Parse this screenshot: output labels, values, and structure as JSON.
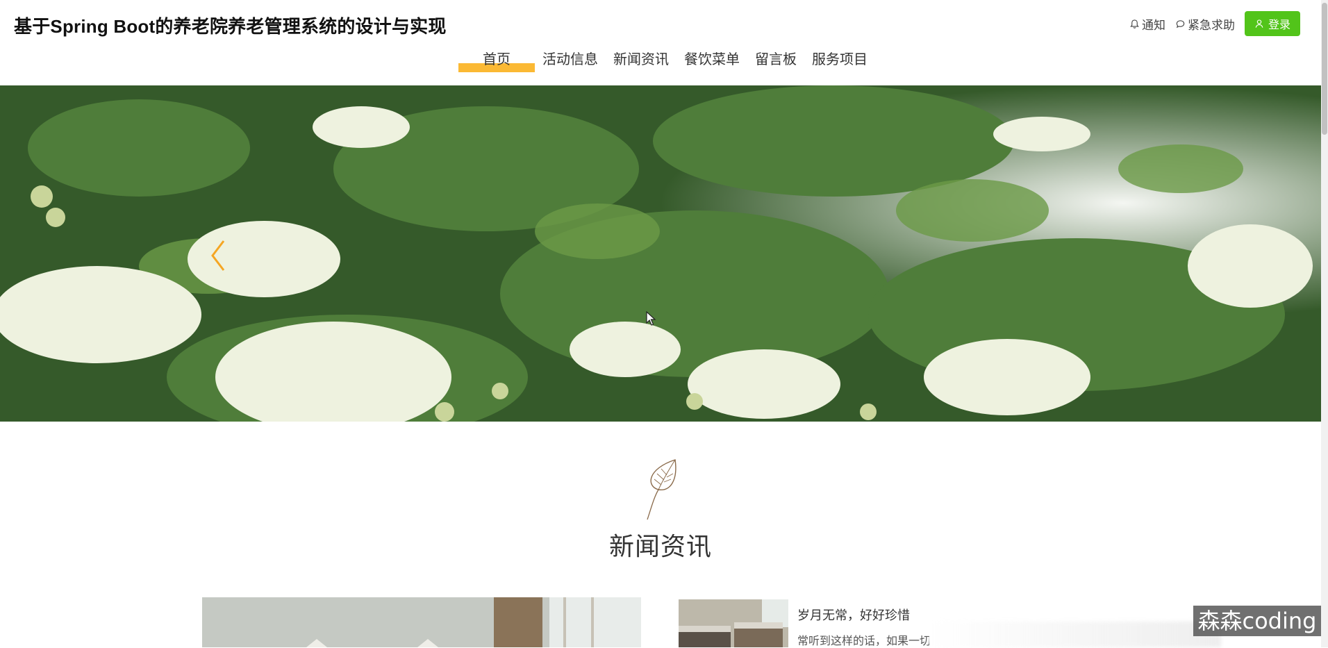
{
  "header": {
    "title": "基于Spring Boot的养老院养老管理系统的设计与实现",
    "notice_label": "通知",
    "emergency_label": "紧急求助",
    "login_label": "登录"
  },
  "nav": {
    "items": [
      {
        "label": "首页",
        "active": true
      },
      {
        "label": "活动信息"
      },
      {
        "label": "新闻资讯"
      },
      {
        "label": "餐饮菜单"
      },
      {
        "label": "留言板"
      },
      {
        "label": "服务项目"
      }
    ]
  },
  "colors": {
    "accent": "#fbb934",
    "login_button": "#52c41a"
  },
  "news": {
    "section_title": "新闻资讯",
    "item_title": "岁月无常，好好珍惜",
    "item_excerpt": "常听到这样的话，如果一切"
  },
  "watermark": "森森coding"
}
